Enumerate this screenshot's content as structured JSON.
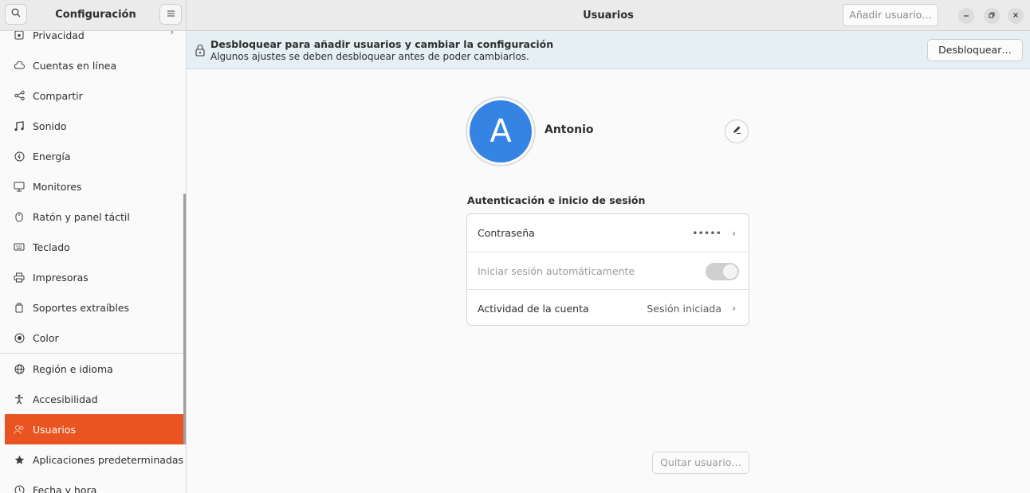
{
  "sidebar": {
    "title": "Configuración",
    "items": [
      {
        "label": "Privacidad",
        "icon": "privacy-icon"
      },
      {
        "label": "Cuentas en línea",
        "icon": "cloud-icon"
      },
      {
        "label": "Compartir",
        "icon": "share-icon"
      },
      {
        "label": "Sonido",
        "icon": "music-note-icon"
      },
      {
        "label": "Energía",
        "icon": "power-icon"
      },
      {
        "label": "Monitores",
        "icon": "monitor-icon"
      },
      {
        "label": "Ratón y panel táctil",
        "icon": "mouse-icon"
      },
      {
        "label": "Teclado",
        "icon": "keyboard-icon"
      },
      {
        "label": "Impresoras",
        "icon": "printer-icon"
      },
      {
        "label": "Soportes extraíbles",
        "icon": "removable-media-icon"
      },
      {
        "label": "Color",
        "icon": "color-icon"
      },
      {
        "label": "Región e idioma",
        "icon": "globe-icon"
      },
      {
        "label": "Accesibilidad",
        "icon": "accessibility-icon"
      },
      {
        "label": "Usuarios",
        "icon": "users-icon"
      },
      {
        "label": "Aplicaciones predeterminadas",
        "icon": "star-icon"
      },
      {
        "label": "Fecha y hora",
        "icon": "clock-icon"
      }
    ],
    "active_index": 13
  },
  "header": {
    "title": "Usuarios",
    "add_user_label": "Añadir usuario…"
  },
  "infobar": {
    "title": "Desbloquear para añadir usuarios y cambiar la configuración",
    "subtitle": "Algunos ajustes se deben desbloquear antes de poder cambiarlos.",
    "unlock_label": "Desbloquear…"
  },
  "user": {
    "initial": "A",
    "name": "Antonio"
  },
  "auth": {
    "section_title": "Autenticación e inicio de sesión",
    "password_label": "Contraseña",
    "password_value": "•••••",
    "autologin_label": "Iniciar sesión automáticamente",
    "activity_label": "Actividad de la cuenta",
    "activity_value": "Sesión iniciada"
  },
  "footer": {
    "remove_user_label": "Quitar usuario…"
  },
  "colors": {
    "accent": "#e95420",
    "avatar": "#3584e4",
    "infobar_bg": "#e6f0f4"
  }
}
